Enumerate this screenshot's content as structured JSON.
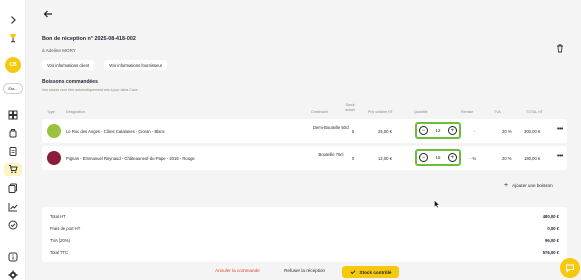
{
  "colors": {
    "accent": "#f6c90e",
    "highlight_border": "#6bbd3b",
    "background": "#f4f4f5",
    "row_dot_1": "#9bc23c",
    "row_dot_2": "#8c1d3a"
  },
  "sidebar": {
    "avatar_initials": "CB",
    "selector_label": "Éta...",
    "icons": [
      "chevron-right-icon",
      "bottle-icon",
      "dashboard-icon",
      "pot-icon",
      "clipboard-icon",
      "cart-icon",
      "documents-icon",
      "chart-icon",
      "check-badge-icon",
      "info-icon",
      "gear-icon"
    ]
  },
  "header": {
    "title": "Bon de réception n° 2025-08-418-002",
    "subtitle": "à Adeline MORY",
    "buttons": {
      "client_info": "Voir informations client",
      "supplier_info": "Voir informations fournisseur"
    }
  },
  "section": {
    "title": "Boissons commandées",
    "subtitle": "Vos stocks vont être automatiquement mis à jour dans Cave."
  },
  "table": {
    "headers": {
      "type": "Type",
      "designation": "Désignation",
      "contenant": "Contenant",
      "stock": "Stock actuel",
      "prix": "Prix unitaire HT",
      "quantite": "Quantité",
      "remise": "Remise",
      "tva": "TVA",
      "total": "TOTAL HT"
    },
    "rows": [
      {
        "designation": "Le Roc des Anges - Côtes Catalanes - Cioran - Blanc",
        "contenant": "Demi-Bouteille 50cl",
        "stock": "5",
        "prix": "25,00 €",
        "quantite": "12",
        "remise": "-",
        "tva": "20 %",
        "total": "300,00 €"
      },
      {
        "designation": "Pignan - Emmanuel Reynaud - Châteauneuf-du-Pape - 2016 - Rouge",
        "contenant": "Bouteille 75cl",
        "stock": "0",
        "prix": "12,00 €",
        "quantite": "15",
        "remise": "- %",
        "tva": "20 %",
        "total": "180,00 €"
      }
    ],
    "add_label": "Ajouter une boisson"
  },
  "totals": {
    "total_ht_label": "Total HT",
    "total_ht": "480,00 €",
    "port_label": "Frais de port HT",
    "port": "0,00 €",
    "tva_label": "TVA (20%)",
    "tva": "96,00 €",
    "ttc_label": "Total TTC",
    "ttc": "576,00 €"
  },
  "footer": {
    "cancel": "Annuler la commande",
    "refuse": "Refuser la réception",
    "confirm": "Stock contrôlé"
  }
}
